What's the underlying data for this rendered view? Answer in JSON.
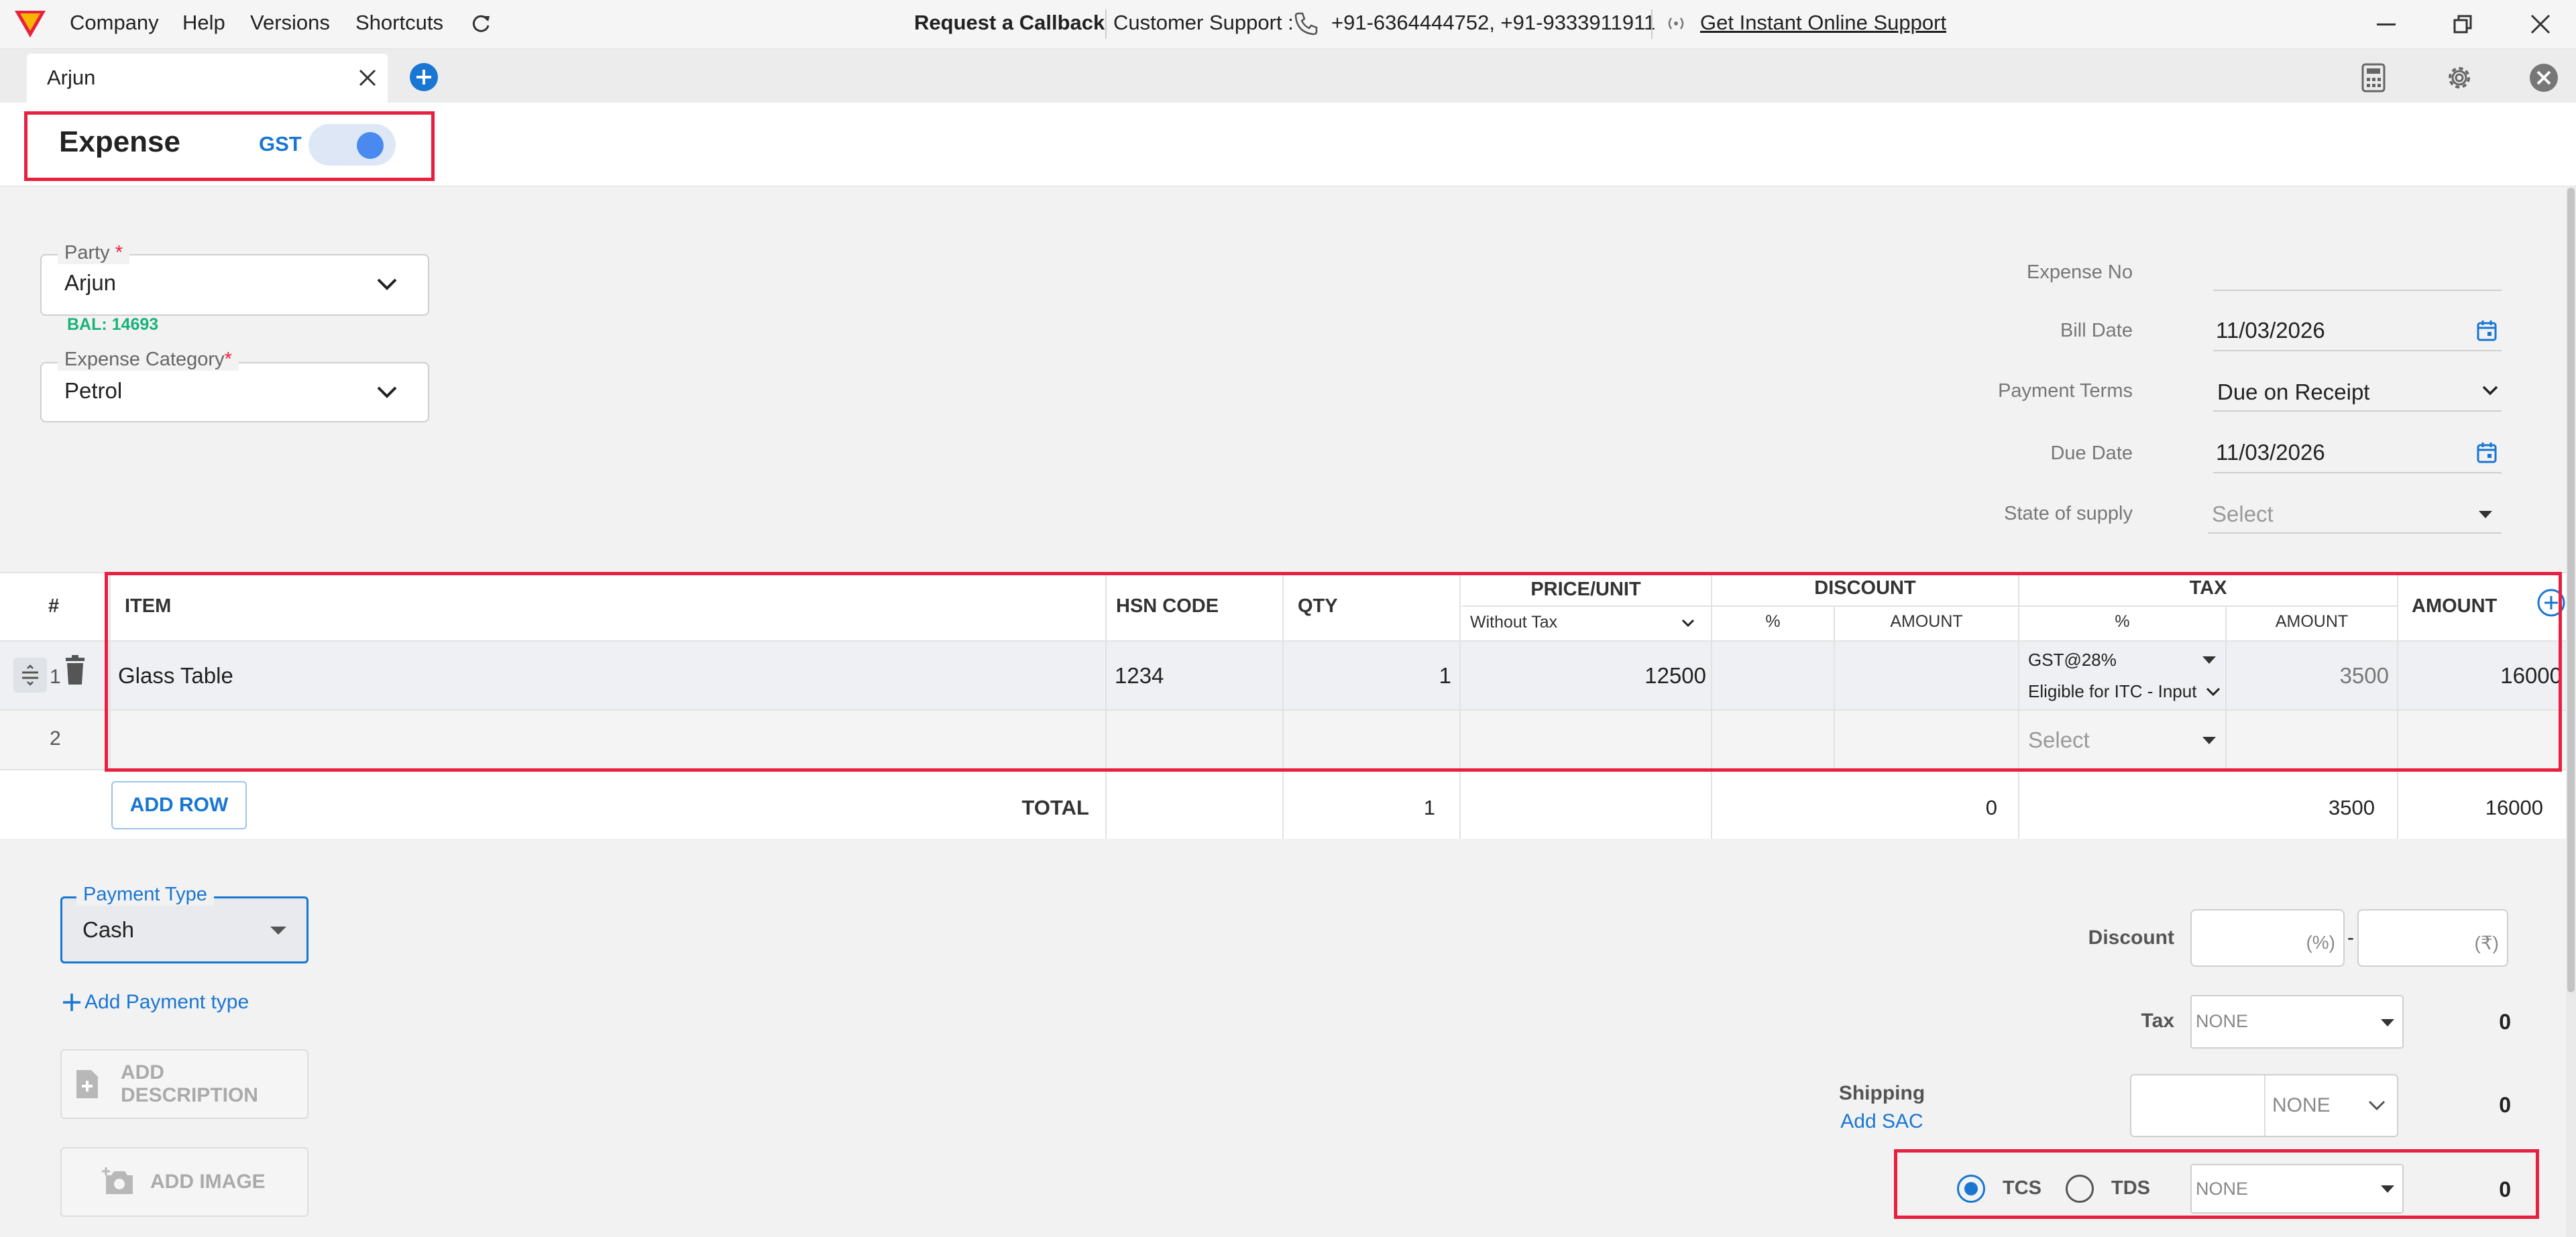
{
  "topbar": {
    "menu": [
      "Company",
      "Help",
      "Versions",
      "Shortcuts"
    ],
    "request_callback": "Request a Callback",
    "support_label": "Customer Support :",
    "support_numbers": "+91-6364444752, +91-9333911911",
    "online_support": "Get Instant Online Support"
  },
  "tab": {
    "label": "Arjun"
  },
  "header": {
    "title": "Expense",
    "gst_label": "GST",
    "gst_on": true
  },
  "party": {
    "label": "Party",
    "required": "*",
    "value": "Arjun",
    "balance": "BAL: 14693"
  },
  "category": {
    "label": "Expense Category",
    "required": "*",
    "value": "Petrol"
  },
  "right": {
    "expense_no_label": "Expense No",
    "bill_date_label": "Bill Date",
    "bill_date": "11/03/2026",
    "payment_terms_label": "Payment Terms",
    "payment_terms": "Due on Receipt",
    "due_date_label": "Due Date",
    "due_date": "11/03/2026",
    "state_label": "State of supply",
    "state_placeholder": "Select"
  },
  "table": {
    "headers": {
      "num": "#",
      "item": "ITEM",
      "hsn": "HSN CODE",
      "qty": "QTY",
      "price": "PRICE/UNIT",
      "price_sub": "Without Tax",
      "discount": "DISCOUNT",
      "disc_pct": "%",
      "disc_amt": "AMOUNT",
      "tax": "TAX",
      "tax_pct": "%",
      "tax_amt": "AMOUNT",
      "amount": "AMOUNT"
    },
    "rows": [
      {
        "num": "1",
        "item": "Glass Table",
        "hsn": "1234",
        "qty": "1",
        "price": "12500",
        "disc_pct": "",
        "disc_amt": "",
        "tax_rate": "GST@28%",
        "itc": "Eligible for ITC - Input",
        "tax_amt": "3500",
        "amount": "16000"
      },
      {
        "num": "2",
        "item": "",
        "hsn": "",
        "qty": "",
        "price": "",
        "disc_pct": "",
        "disc_amt": "",
        "tax_placeholder": "Select",
        "tax_amt": "",
        "amount": ""
      }
    ],
    "add_row": "ADD ROW",
    "total_label": "TOTAL",
    "total_qty": "1",
    "total_discount": "0",
    "total_tax": "3500",
    "total_amount": "16000"
  },
  "payment": {
    "label": "Payment Type",
    "value": "Cash",
    "add_type": "Add Payment type"
  },
  "buttons": {
    "add_description": "ADD DESCRIPTION",
    "add_image": "ADD IMAGE"
  },
  "summary": {
    "discount_label": "Discount",
    "discount_pct_suffix": "(%)",
    "dash": "-",
    "discount_amt_suffix": "(₹)",
    "tax_label": "Tax",
    "tax_select": "NONE",
    "tax_value": "0",
    "shipping_label": "Shipping",
    "add_sac": "Add SAC",
    "shipping_select": "NONE",
    "shipping_value": "0",
    "tcs_label": "TCS",
    "tds_label": "TDS",
    "tcs_selected": true,
    "tcs_select": "NONE",
    "tcs_value": "0"
  },
  "colors": {
    "accent": "#1976d2",
    "highlight": "#e8203f",
    "balance": "#19b37a"
  }
}
